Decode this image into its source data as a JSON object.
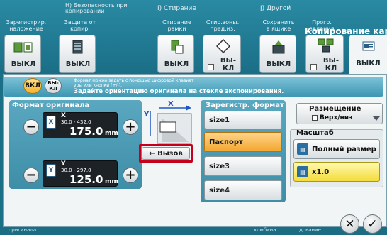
{
  "categories": [
    {
      "id": "reg",
      "title": "",
      "label": "Зарегистрир.\nналожение",
      "value": "ВЫКЛ"
    },
    {
      "id": "H",
      "title": "H) Безопасность при\nкопировании",
      "label": "Защита от\nкопир.",
      "value": "ВЫКЛ"
    },
    {
      "id": "I1",
      "title": "I) Стирание",
      "label": "Стирание\nрамки",
      "value": "ВЫКЛ"
    },
    {
      "id": "I2",
      "title": "",
      "label": "Стир.зоны.\nпред.из.",
      "value": "ВЫ-\nКЛ"
    },
    {
      "id": "J1",
      "title": "J) Другой",
      "label": "Сохранить\nв ящике",
      "value": "ВЫКЛ"
    },
    {
      "id": "J2",
      "title": "",
      "label": "Прогр.\nзадания",
      "value": "ВЫ-\nКЛ"
    }
  ],
  "header_title": "Копирование кар",
  "active_tab_value": "ВЫКЛ",
  "toggle": {
    "on_label": "ВКЛ",
    "off_label": "ВЫ-\nКЛ"
  },
  "hint": {
    "line1": "Формат можно задать с помощью цифровой клавиат\nуры или кнопки [+/-].",
    "line2": "Задайте ориентацию оригинала на стекле экспонирования."
  },
  "original_format": {
    "title": "Формат оригинала",
    "x": {
      "axis": "X",
      "range": "30.0 - 432.0",
      "value": "175.0",
      "unit": "mm"
    },
    "y": {
      "axis": "Y",
      "range": "30.0 - 297.0",
      "value": "125.0",
      "unit": "mm"
    }
  },
  "diagram": {
    "x": "X",
    "y": "Y"
  },
  "recall_label": "← Вызов",
  "registered": {
    "title": "Зарегистр. формат",
    "items": [
      "size1",
      "Паспорт",
      "size3",
      "size4"
    ],
    "selected": 1
  },
  "placement": {
    "label": "Размещение",
    "value": "Верх/низ"
  },
  "scale": {
    "title": "Масштаб",
    "full_label": "Полный размер",
    "ratio_label": "x1.0"
  },
  "bottom_labels": [
    "оригинала",
    "комбина",
    "дование"
  ],
  "colors": {
    "accent": "#f3a72f",
    "highlight_border": "#c4001a"
  }
}
